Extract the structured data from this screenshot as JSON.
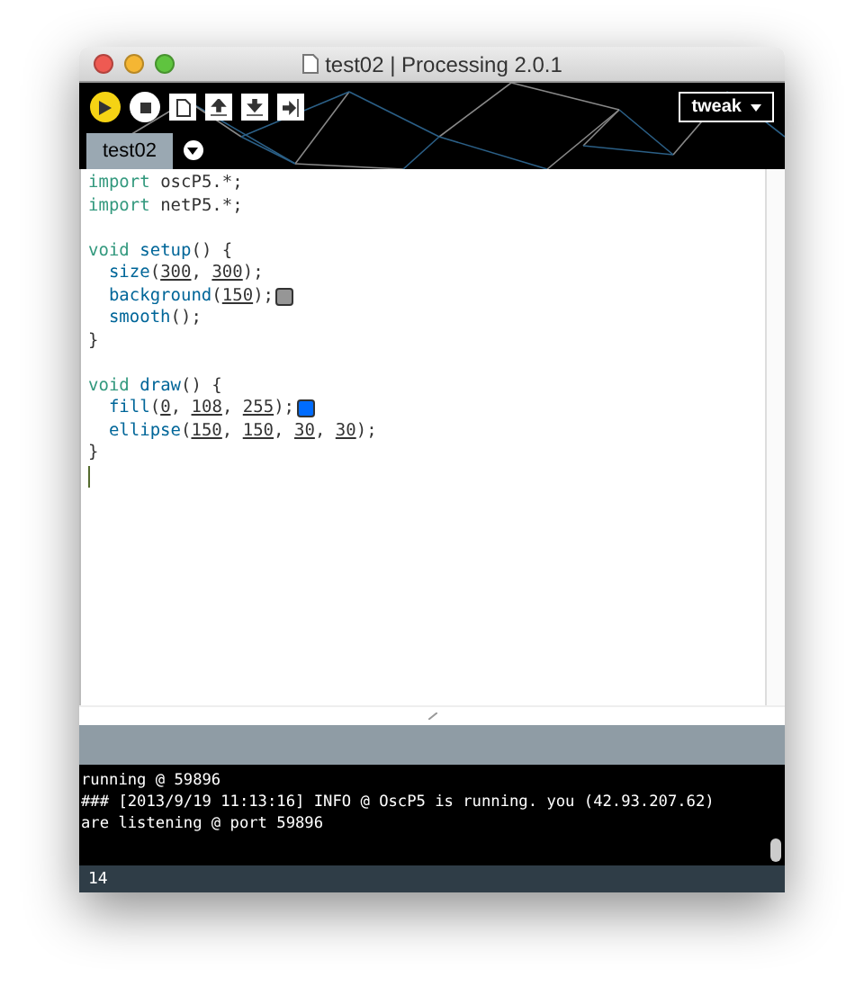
{
  "window": {
    "title": "test02 | Processing 2.0.1"
  },
  "toolbar": {
    "buttons": [
      {
        "kind": "run",
        "selected": true
      },
      {
        "kind": "stop",
        "selected": false
      },
      {
        "kind": "new"
      },
      {
        "kind": "open"
      },
      {
        "kind": "save"
      },
      {
        "kind": "export"
      }
    ],
    "mode": "tweak"
  },
  "tabs": [
    {
      "label": "test02",
      "selected": true
    }
  ],
  "code": {
    "lines": [
      {
        "kind": "code",
        "tokens": [
          {
            "kind": "keyword",
            "text": "import"
          },
          {
            "kind": "plain",
            "text": "oscP5.*;"
          }
        ]
      },
      {
        "kind": "code",
        "tokens": [
          {
            "kind": "keyword",
            "text": "import"
          },
          {
            "kind": "plain",
            "text": "netP5.*;"
          }
        ]
      },
      {
        "kind": "blank"
      },
      {
        "kind": "code",
        "tokens": [
          {
            "kind": "keyword",
            "text": "void"
          },
          {
            "kind": "function",
            "text": "setup"
          },
          {
            "kind": "plain",
            "text": "() {"
          }
        ]
      },
      {
        "kind": "code",
        "indent": true,
        "tokens": [
          {
            "kind": "function",
            "text": "size"
          },
          {
            "kind": "plain",
            "text": "("
          },
          {
            "kind": "number",
            "text": "300"
          },
          {
            "kind": "plain",
            "text": ", "
          },
          {
            "kind": "number",
            "text": "300"
          },
          {
            "kind": "plain",
            "text": ");"
          }
        ]
      },
      {
        "kind": "code",
        "indent": true,
        "color": "#969696",
        "tokens": [
          {
            "kind": "function",
            "text": "background"
          },
          {
            "kind": "plain",
            "text": "("
          },
          {
            "kind": "number",
            "text": "150"
          },
          {
            "kind": "plain",
            "text": ");"
          }
        ]
      },
      {
        "kind": "code",
        "indent": true,
        "tokens": [
          {
            "kind": "function",
            "text": "smooth"
          },
          {
            "kind": "plain",
            "text": "();"
          }
        ]
      },
      {
        "kind": "code",
        "tokens": [
          {
            "kind": "plain",
            "text": "}"
          }
        ]
      },
      {
        "kind": "blank"
      },
      {
        "kind": "code",
        "tokens": [
          {
            "kind": "keyword",
            "text": "void"
          },
          {
            "kind": "function",
            "text": "draw"
          },
          {
            "kind": "plain",
            "text": "() {"
          }
        ]
      },
      {
        "kind": "code",
        "indent": true,
        "color": "#006cff",
        "tokens": [
          {
            "kind": "function",
            "text": "fill"
          },
          {
            "kind": "plain",
            "text": "("
          },
          {
            "kind": "number",
            "text": "0"
          },
          {
            "kind": "plain",
            "text": ", "
          },
          {
            "kind": "number",
            "text": "108"
          },
          {
            "kind": "plain",
            "text": ", "
          },
          {
            "kind": "number",
            "text": "255"
          },
          {
            "kind": "plain",
            "text": ");"
          }
        ]
      },
      {
        "kind": "code",
        "indent": true,
        "tokens": [
          {
            "kind": "function",
            "text": "ellipse"
          },
          {
            "kind": "plain",
            "text": "("
          },
          {
            "kind": "number",
            "text": "150"
          },
          {
            "kind": "plain",
            "text": ", "
          },
          {
            "kind": "number",
            "text": "150"
          },
          {
            "kind": "plain",
            "text": ", "
          },
          {
            "kind": "number",
            "text": "30"
          },
          {
            "kind": "plain",
            "text": ", "
          },
          {
            "kind": "number",
            "text": "30"
          },
          {
            "kind": "plain",
            "text": ");"
          }
        ]
      },
      {
        "kind": "code",
        "tokens": [
          {
            "kind": "plain",
            "text": "}"
          }
        ]
      },
      {
        "kind": "cursor"
      }
    ]
  },
  "console": {
    "lines": [
      "running @ 59896",
      "### [2013/9/19 11:13:16] INFO @ OscP5 is running. you (42.93.207.62)",
      "are listening @ port 59896"
    ]
  },
  "status_bar": {
    "line": "14"
  }
}
